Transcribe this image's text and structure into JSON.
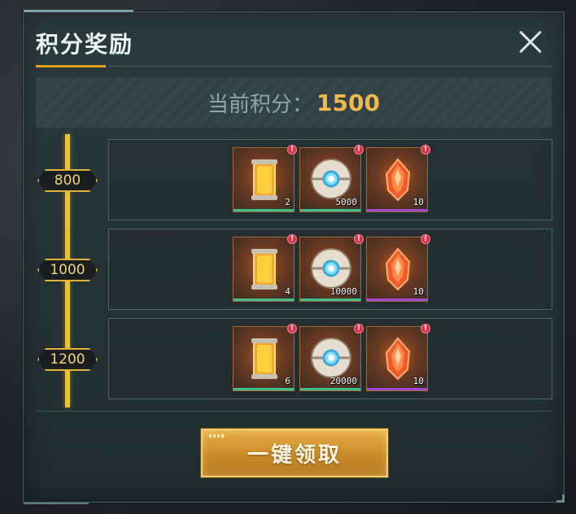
{
  "title": "积分奖励",
  "score": {
    "label": "当前积分：",
    "value": "1500"
  },
  "tiers": [
    {
      "points": "800",
      "rewards": [
        {
          "icon": "energy-canister-icon",
          "count": "2",
          "rarity": "green"
        },
        {
          "icon": "orb-capsule-icon",
          "count": "5000",
          "rarity": "green"
        },
        {
          "icon": "fire-crystal-icon",
          "count": "10",
          "rarity": "purple"
        }
      ]
    },
    {
      "points": "1000",
      "rewards": [
        {
          "icon": "energy-canister-icon",
          "count": "4",
          "rarity": "green"
        },
        {
          "icon": "orb-capsule-icon",
          "count": "10000",
          "rarity": "green"
        },
        {
          "icon": "fire-crystal-icon",
          "count": "10",
          "rarity": "purple"
        }
      ]
    },
    {
      "points": "1200",
      "rewards": [
        {
          "icon": "energy-canister-icon",
          "count": "6",
          "rarity": "green"
        },
        {
          "icon": "orb-capsule-icon",
          "count": "20000",
          "rarity": "green"
        },
        {
          "icon": "fire-crystal-icon",
          "count": "10",
          "rarity": "purple"
        }
      ]
    }
  ],
  "badge_glyph": "!",
  "claim_button": {
    "label": "一键领取"
  },
  "colors": {
    "accent_gold": "#f2b84a",
    "track": "#f0c030",
    "badge": "#d8334a",
    "panel": "#263438"
  }
}
